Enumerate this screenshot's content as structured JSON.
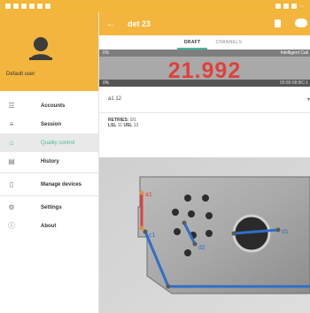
{
  "colors": {
    "accent": "#f3b53e",
    "active": "#43b99a",
    "measure_red": "#e0403c",
    "line_blue": "#2f6fc8"
  },
  "status_bar": {
    "right_text": "⋯"
  },
  "drawer": {
    "user_name": "Default user",
    "items": [
      {
        "label": "Accounts",
        "icon": "account-icon",
        "glyph": "☰"
      },
      {
        "label": "Session",
        "icon": "list-icon",
        "glyph": "≡"
      },
      {
        "label": "Quality control",
        "icon": "quality-icon",
        "glyph": "⌂",
        "active": true
      },
      {
        "label": "History",
        "icon": "history-icon",
        "glyph": "▤"
      },
      {
        "label": "Manage devices",
        "icon": "device-icon",
        "glyph": "▯"
      },
      {
        "label": "Settings",
        "icon": "gear-icon",
        "glyph": "⚙"
      },
      {
        "label": "About",
        "icon": "info-icon",
        "glyph": "ⓘ"
      }
    ]
  },
  "appbar": {
    "back": "←",
    "title": "det 23"
  },
  "tabs": {
    "draft": "DRAFT",
    "channels": "CHANNELS"
  },
  "gauge": {
    "top_pct": "0%",
    "device_label": "Intelligent Cali",
    "value": "21.992",
    "bottom_pct": "0%",
    "mac": "00:80:98:BC:1",
    "fill_fraction": 0.0
  },
  "selector": {
    "value": "a1 12",
    "arrow": "▾"
  },
  "info": {
    "retries_label": "RETRIES:",
    "retries_value": "0/1",
    "lsl_label": "LSL",
    "lsl_value": "11",
    "usl_label": "USL",
    "usl_value": "13"
  },
  "photo": {
    "labels": [
      "a1",
      "c1",
      "d2",
      "d1"
    ]
  }
}
